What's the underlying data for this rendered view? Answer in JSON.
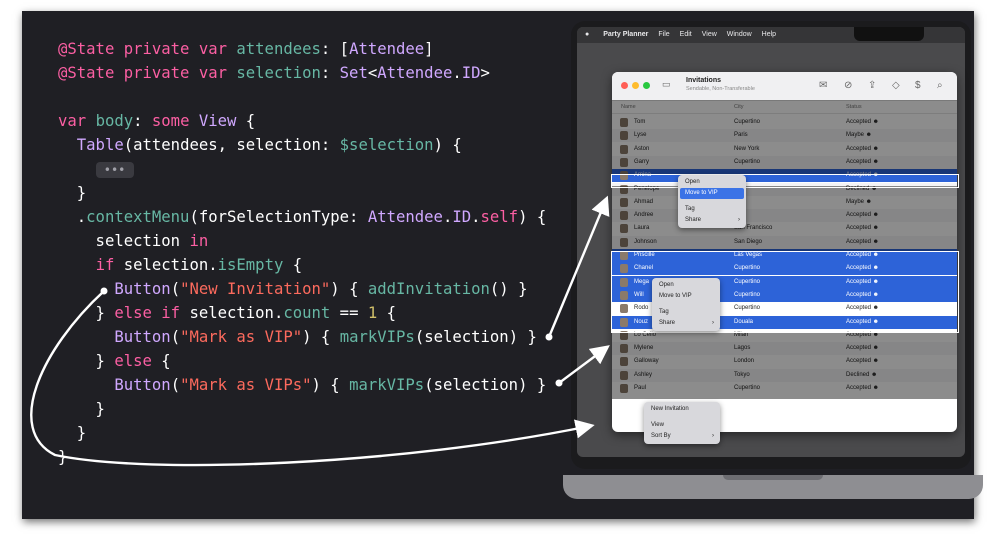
{
  "code_lines": [
    [
      {
        "t": "@State ",
        "c": "kw"
      },
      {
        "t": "private ",
        "c": "kw"
      },
      {
        "t": "var ",
        "c": "kw"
      },
      {
        "t": "attendees",
        "c": "fn"
      },
      {
        "t": ": [",
        "c": "pl"
      },
      {
        "t": "Attendee",
        "c": "ty"
      },
      {
        "t": "]",
        "c": "pl"
      }
    ],
    [
      {
        "t": "@State ",
        "c": "kw"
      },
      {
        "t": "private ",
        "c": "kw"
      },
      {
        "t": "var ",
        "c": "kw"
      },
      {
        "t": "selection",
        "c": "fn"
      },
      {
        "t": ": ",
        "c": "pl"
      },
      {
        "t": "Set",
        "c": "ty"
      },
      {
        "t": "<",
        "c": "pl"
      },
      {
        "t": "Attendee",
        "c": "ty"
      },
      {
        "t": ".",
        "c": "pl"
      },
      {
        "t": "ID",
        "c": "ty"
      },
      {
        "t": ">",
        "c": "pl"
      }
    ],
    [],
    [
      {
        "t": "var ",
        "c": "kw"
      },
      {
        "t": "body",
        "c": "fn"
      },
      {
        "t": ": ",
        "c": "pl"
      },
      {
        "t": "some ",
        "c": "kw"
      },
      {
        "t": "View",
        "c": "ty"
      },
      {
        "t": " {",
        "c": "pl"
      }
    ],
    [
      {
        "t": "  ",
        "c": "pl"
      },
      {
        "t": "Table",
        "c": "ty"
      },
      {
        "t": "(attendees, selection: ",
        "c": "pl"
      },
      {
        "t": "$selection",
        "c": "fn"
      },
      {
        "t": ") {",
        "c": "pl"
      }
    ],
    [
      {
        "t": "    ",
        "c": "pl"
      },
      {
        "t": "•••",
        "c": "ellipsis"
      }
    ],
    [
      {
        "t": "  }",
        "c": "pl"
      }
    ],
    [
      {
        "t": "  .",
        "c": "pl"
      },
      {
        "t": "contextMenu",
        "c": "fn"
      },
      {
        "t": "(forSelectionType: ",
        "c": "pl"
      },
      {
        "t": "Attendee",
        "c": "ty"
      },
      {
        "t": ".",
        "c": "pl"
      },
      {
        "t": "ID",
        "c": "ty"
      },
      {
        "t": ".",
        "c": "pl"
      },
      {
        "t": "self",
        "c": "kw"
      },
      {
        "t": ") {",
        "c": "pl"
      }
    ],
    [
      {
        "t": "    selection ",
        "c": "pl"
      },
      {
        "t": "in",
        "c": "kw"
      }
    ],
    [
      {
        "t": "    ",
        "c": "pl"
      },
      {
        "t": "if ",
        "c": "kw"
      },
      {
        "t": "selection.",
        "c": "pl"
      },
      {
        "t": "isEmpty",
        "c": "fn"
      },
      {
        "t": " {",
        "c": "pl"
      }
    ],
    [
      {
        "t": "      ",
        "c": "pl"
      },
      {
        "t": "Button",
        "c": "ty"
      },
      {
        "t": "(",
        "c": "pl"
      },
      {
        "t": "\"New Invitation\"",
        "c": "str"
      },
      {
        "t": ") { ",
        "c": "pl"
      },
      {
        "t": "addInvitation",
        "c": "fn"
      },
      {
        "t": "() }",
        "c": "pl"
      }
    ],
    [
      {
        "t": "    } ",
        "c": "pl"
      },
      {
        "t": "else if ",
        "c": "kw"
      },
      {
        "t": "selection.",
        "c": "pl"
      },
      {
        "t": "count",
        "c": "fn"
      },
      {
        "t": " == ",
        "c": "pl"
      },
      {
        "t": "1",
        "c": "num"
      },
      {
        "t": " {",
        "c": "pl"
      }
    ],
    [
      {
        "t": "      ",
        "c": "pl"
      },
      {
        "t": "Button",
        "c": "ty"
      },
      {
        "t": "(",
        "c": "pl"
      },
      {
        "t": "\"Mark as VIP\"",
        "c": "str"
      },
      {
        "t": ") { ",
        "c": "pl"
      },
      {
        "t": "markVIPs",
        "c": "fn"
      },
      {
        "t": "(selection) }",
        "c": "pl"
      }
    ],
    [
      {
        "t": "    } ",
        "c": "pl"
      },
      {
        "t": "else",
        "c": "kw"
      },
      {
        "t": " {",
        "c": "pl"
      }
    ],
    [
      {
        "t": "      ",
        "c": "pl"
      },
      {
        "t": "Button",
        "c": "ty"
      },
      {
        "t": "(",
        "c": "pl"
      },
      {
        "t": "\"Mark as VIPs\"",
        "c": "str"
      },
      {
        "t": ") { ",
        "c": "pl"
      },
      {
        "t": "markVIPs",
        "c": "fn"
      },
      {
        "t": "(selection) }",
        "c": "pl"
      }
    ],
    [
      {
        "t": "    }",
        "c": "pl"
      }
    ],
    [
      {
        "t": "  }",
        "c": "pl"
      }
    ],
    [
      {
        "t": "}",
        "c": "pl"
      }
    ]
  ],
  "menubar": {
    "app": "Party Planner",
    "items": [
      "File",
      "Edit",
      "View",
      "Window",
      "Help"
    ]
  },
  "window": {
    "title": "Invitations",
    "subtitle": "Sendable, Non-Transferable",
    "columns": [
      "Name",
      "City",
      "Status"
    ]
  },
  "rows": [
    {
      "name": "Tom",
      "city": "Cupertino",
      "status": "Accepted ☻",
      "state": "normal"
    },
    {
      "name": "Lyse",
      "city": "Paris",
      "status": "Maybe ☻",
      "state": "normal"
    },
    {
      "name": "Aston",
      "city": "New York",
      "status": "Accepted ☻",
      "state": "normal"
    },
    {
      "name": "Garry",
      "city": "Cupertino",
      "status": "Accepted ☻",
      "state": "normal"
    },
    {
      "name": "Amina",
      "city": "",
      "status": "Accepted ☻",
      "state": "selected"
    },
    {
      "name": "Penelope",
      "city": "",
      "status": "Declined ☻",
      "state": "normal"
    },
    {
      "name": "Ahmad",
      "city": "",
      "status": "Maybe ☻",
      "state": "normal"
    },
    {
      "name": "Andree",
      "city": "",
      "status": "Accepted ☻",
      "state": "normal"
    },
    {
      "name": "Laura",
      "city": "San Francisco",
      "status": "Accepted ☻",
      "state": "normal"
    },
    {
      "name": "Johnson",
      "city": "San Diego",
      "status": "Accepted ☻",
      "state": "normal"
    },
    {
      "name": "Priscille",
      "city": "Las Vegas",
      "status": "Accepted ☻",
      "state": "selected"
    },
    {
      "name": "Chanel",
      "city": "Cupertino",
      "status": "Accepted ☻",
      "state": "selected"
    },
    {
      "name": "Mega",
      "city": "Cupertino",
      "status": "Accepted ☻",
      "state": "selected"
    },
    {
      "name": "Will",
      "city": "Cupertino",
      "status": "Accepted ☻",
      "state": "selected"
    },
    {
      "name": "Rodo",
      "city": "Cupertino",
      "status": "Accepted ☻",
      "state": "normal"
    },
    {
      "name": "Nouz",
      "city": "Douala",
      "status": "Accepted ☻",
      "state": "selected"
    },
    {
      "name": "Lo Celio",
      "city": "Milan",
      "status": "Accepted ☻",
      "state": "normal"
    },
    {
      "name": "Mylene",
      "city": "Lagos",
      "status": "Accepted ☻",
      "state": "normal"
    },
    {
      "name": "Galloway",
      "city": "London",
      "status": "Accepted ☻",
      "state": "normal"
    },
    {
      "name": "Ashley",
      "city": "Tokyo",
      "status": "Declined ☻",
      "state": "normal"
    },
    {
      "name": "Paul",
      "city": "Cupertino",
      "status": "Accepted ☻",
      "state": "normal"
    }
  ],
  "menus": [
    {
      "items": [
        {
          "label": "Open"
        },
        {
          "label": "Move to VIP",
          "highlight": true
        },
        {
          "sep": true
        },
        {
          "label": "Tag"
        },
        {
          "label": "Share",
          "submenu": true
        }
      ]
    },
    {
      "items": [
        {
          "label": "Open"
        },
        {
          "label": "Move to VIP"
        },
        {
          "sep": true
        },
        {
          "label": "Tag"
        },
        {
          "label": "Share",
          "submenu": true
        }
      ]
    },
    {
      "items": [
        {
          "label": "New Invitation"
        },
        {
          "sep": true
        },
        {
          "label": "View"
        },
        {
          "label": "Sort By",
          "submenu": true
        }
      ]
    }
  ],
  "colors": {
    "background": "#1f1f24",
    "keyword": "#fc5fa3",
    "function": "#67b7a4",
    "string": "#fc6a5d",
    "number": "#d0bf69",
    "type": "#d0a8ff",
    "selection": "#2d63d8"
  }
}
